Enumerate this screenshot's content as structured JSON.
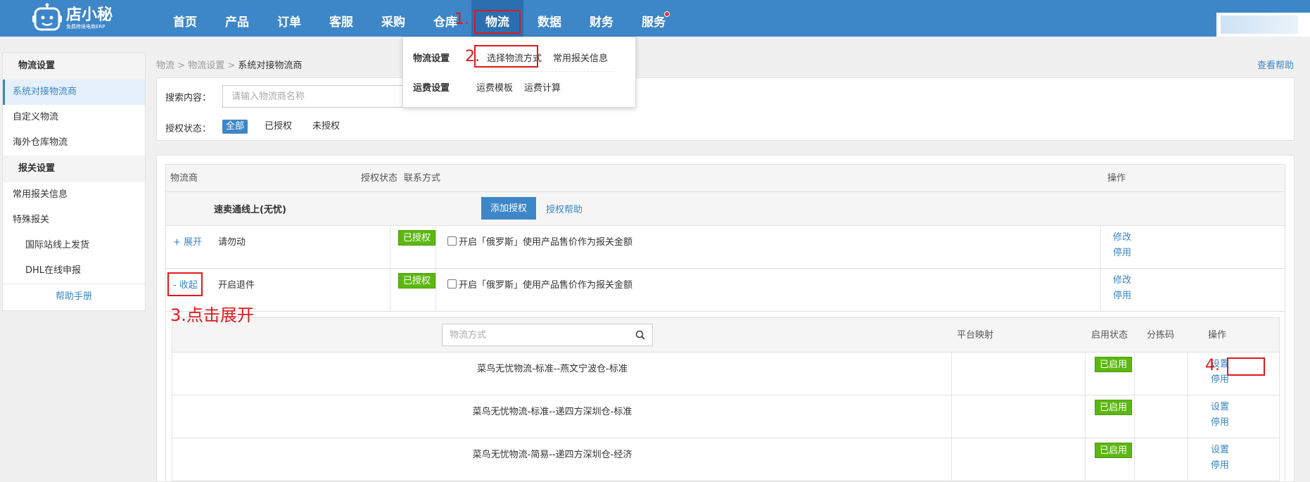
{
  "logo": {
    "name": "店小秘",
    "sub": "免费跨境电商ERP"
  },
  "nav": [
    "首页",
    "产品",
    "订单",
    "客服",
    "采购",
    "仓库",
    "物流",
    "数据",
    "财务",
    "服务"
  ],
  "nav_active": "物流",
  "dropdown": {
    "logistics_head": "物流设置",
    "logistics_links": [
      "选择物流方式",
      "常用报关信息"
    ],
    "freight_head": "运费设置",
    "freight_links": [
      "运费模板",
      "运费计算"
    ]
  },
  "annotations": {
    "step1": "1.",
    "step2": "2.",
    "step3": "3.点击展开",
    "step4": "4."
  },
  "sidebar": {
    "group1": "物流设置",
    "items1": [
      "系统对接物流商",
      "自定义物流",
      "海外仓库物流"
    ],
    "group2": "报关设置",
    "items2": [
      "常用报关信息",
      "特殊报关"
    ],
    "sub_items": [
      "国际站线上发货",
      "DHL在线申报"
    ],
    "help": "帮助手册"
  },
  "breadcrumb": {
    "a": "物流",
    "sep": ">",
    "b": "物流设置",
    "c": "系统对接物流商"
  },
  "help_link": "查看帮助",
  "search": {
    "label": "搜索内容：",
    "placeholder": "请输入物流商名称",
    "status_label": "授权状态：",
    "filters": [
      "全部",
      "已授权",
      "未授权"
    ]
  },
  "table": {
    "headers": {
      "provider": "物流商",
      "auth": "授权状态",
      "contact": "联系方式",
      "ops": "操作"
    },
    "group": {
      "name": "速卖通线上(无忧)",
      "add_btn": "添加授权",
      "auth_help": "授权帮助"
    },
    "rows": [
      {
        "toggle": "+ 展开",
        "name": "请勿动",
        "badge": "已授权",
        "option": "开启「俄罗斯」使用产品售价作为报关金额",
        "op1": "修改",
        "op2": "停用"
      },
      {
        "toggle": "- 收起",
        "name": "开启退件",
        "badge": "已授权",
        "option": "开启「俄罗斯」使用产品售价作为报关金额",
        "op1": "修改",
        "op2": "停用"
      }
    ]
  },
  "subtable": {
    "search_placeholder": "物流方式",
    "headers": {
      "mapping": "平台映射",
      "status": "启用状态",
      "sort_code": "分拣码",
      "ops": "操作"
    },
    "rows": [
      {
        "name": "菜鸟无忧物流-标准--燕文宁波仓-标准",
        "badge": "已启用",
        "op1": "设置",
        "op2": "停用"
      },
      {
        "name": "菜鸟无忧物流-标准--递四方深圳仓-标准",
        "badge": "已启用",
        "op1": "设置",
        "op2": "停用"
      },
      {
        "name": "菜鸟无忧物流-简易--递四方深圳仓-经济",
        "badge": "已启用",
        "op1": "设置",
        "op2": "停用"
      }
    ]
  },
  "colors": {
    "primary": "#3d86c8",
    "badge_green": "#5cb811",
    "annotation_red": "#e0181c"
  }
}
